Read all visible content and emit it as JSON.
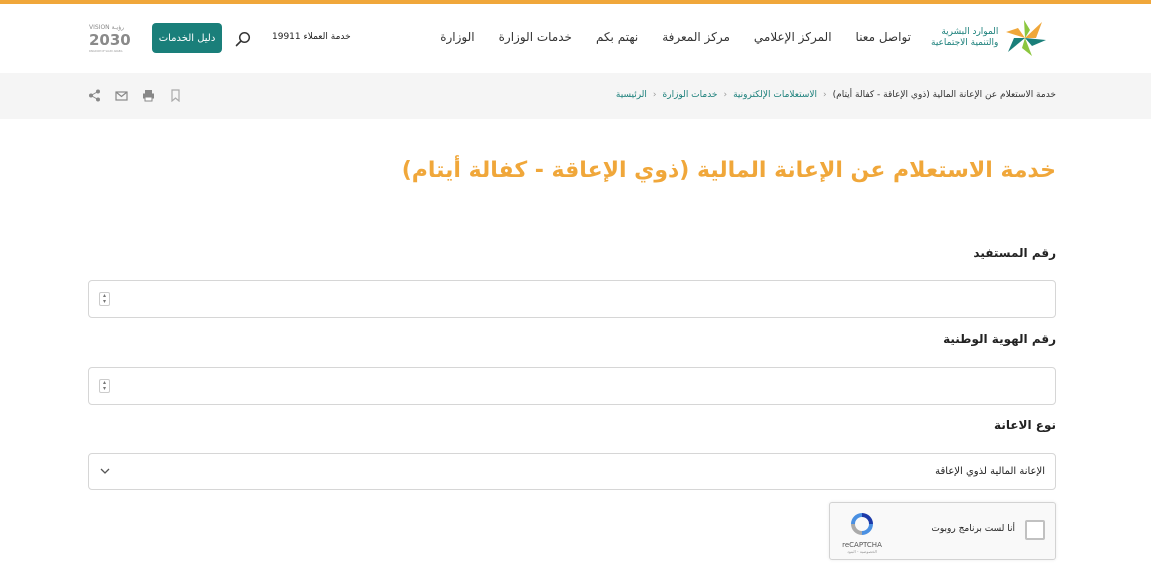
{
  "header": {
    "logo_line1": "الموارد البشرية",
    "logo_line2": "والتنمية الاجتماعية",
    "nav": [
      {
        "label": "الوزارة"
      },
      {
        "label": "خدمات الوزارة"
      },
      {
        "label": "نهتم بكم"
      },
      {
        "label": "مركز المعرفة"
      },
      {
        "label": "المركز الإعلامي"
      },
      {
        "label": "تواصل معنا"
      }
    ],
    "customer_service": "خدمة العملاء 19911",
    "services_button": "دليل الخدمات",
    "vision_top": "VISION رؤيـة",
    "vision_year": "2030",
    "vision_bottom": "KINGDOM OF SAUDI ARABIA"
  },
  "breadcrumb": {
    "items": [
      {
        "label": "الرئيسية"
      },
      {
        "label": "خدمات الوزارة"
      },
      {
        "label": "الاستعلامات الإلكترونية"
      }
    ],
    "current": "خدمة الاستعلام عن الإعانة المالية (ذوي الإعاقة - كفالة أيتام)"
  },
  "page": {
    "title": "خدمة الاستعلام عن الإعانة المالية (ذوي الإعاقة - كفالة أيتام)"
  },
  "form": {
    "beneficiary_label": "رقم المستفيد",
    "national_id_label": "رقم الهوية الوطنية",
    "aid_type_label": "نوع الاعانة",
    "aid_type_value": "الإعانة المالية لذوي الإعاقة"
  },
  "recaptcha": {
    "label": "أنا لست برنامج روبوت",
    "brand": "reCAPTCHA",
    "terms": "الخصوصية - البنود"
  },
  "colors": {
    "accent": "#f0a73a",
    "brand": "#1a7f7a"
  }
}
